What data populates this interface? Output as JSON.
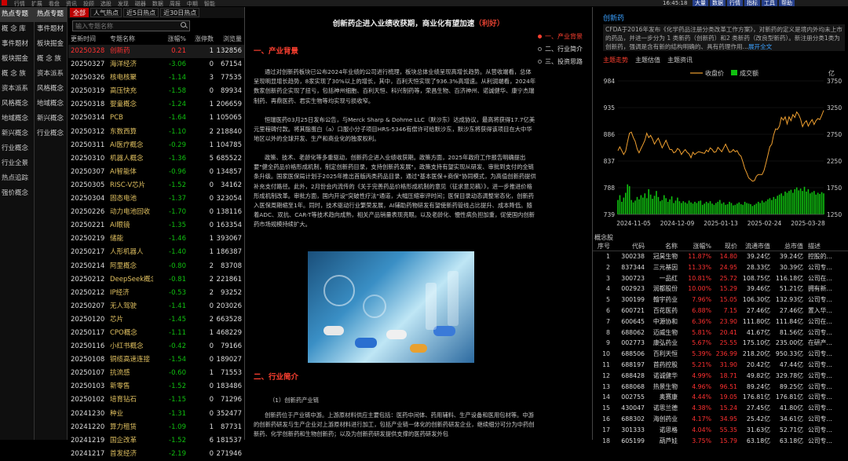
{
  "menubar": {
    "items": [
      "行情",
      "扩展",
      "看盘",
      "资讯",
      "投顾",
      "选股",
      "发现",
      "磁器",
      "数据",
      "周报",
      "中期",
      "智能"
    ],
    "clock": "16:45:18",
    "buttons": [
      "大量",
      "数据",
      "行情",
      "指标",
      "工具",
      "帮助"
    ]
  },
  "sidebar_primary": [
    "热点专题",
    "概 念 库",
    "事件题材",
    "板块掘金",
    "概 念 族",
    "资本派系",
    "风格概念",
    "地域概念",
    "新兴概念",
    "行业概念",
    "行业全景",
    "热点追踪",
    "强价概念"
  ],
  "sidebar_secondary": [
    "热点专题",
    "事件题材",
    "板块掘金",
    "概 念 族",
    "资本派系",
    "风格概念",
    "地域概念",
    "新兴概念",
    "行业概念"
  ],
  "list_tabs": [
    "全部",
    "人气热点",
    "近5日热点",
    "近30日热点"
  ],
  "search": {
    "placeholder": "输入专题名称"
  },
  "list_header": {
    "date": "更新时间",
    "name": "专题名称",
    "chg": "涨幅%",
    "stocks": "涨停数",
    "views": "浏览量"
  },
  "list_rows": [
    {
      "date": "20250328",
      "name": "创新药",
      "chg": "0.21",
      "stocks": "1",
      "views": "132856",
      "sel": true
    },
    {
      "date": "20250327",
      "name": "海洋经济",
      "chg": "-3.06",
      "stocks": "0",
      "views": "67154"
    },
    {
      "date": "20250326",
      "name": "核电核聚",
      "chg": "-1.14",
      "stocks": "3",
      "views": "77535"
    },
    {
      "date": "20250319",
      "name": "高压快充",
      "chg": "-1.58",
      "stocks": "0",
      "views": "89934"
    },
    {
      "date": "20250318",
      "name": "婴童概念",
      "chg": "-1.24",
      "stocks": "1",
      "views": "206659"
    },
    {
      "date": "20250314",
      "name": "PCB",
      "chg": "-1.64",
      "stocks": "1",
      "views": "105065"
    },
    {
      "date": "20250312",
      "name": "东数西算",
      "chg": "-1.10",
      "stocks": "2",
      "views": "218840"
    },
    {
      "date": "20250311",
      "name": "AI医疗概念",
      "chg": "-0.29",
      "stocks": "1",
      "views": "104785"
    },
    {
      "date": "20250310",
      "name": "机器人概念",
      "chg": "-1.36",
      "stocks": "5",
      "views": "685522"
    },
    {
      "date": "20250307",
      "name": "AI智能体",
      "chg": "-0.96",
      "stocks": "0",
      "views": "134857"
    },
    {
      "date": "20250305",
      "name": "RISC-V芯片",
      "chg": "-1.52",
      "stocks": "0",
      "views": "34162"
    },
    {
      "date": "20250304",
      "name": "固态电池",
      "chg": "-1.37",
      "stocks": "0",
      "views": "323054"
    },
    {
      "date": "20250226",
      "name": "动力电池回收",
      "chg": "-1.70",
      "stocks": "0",
      "views": "138116"
    },
    {
      "date": "20250221",
      "name": "AI眼镜",
      "chg": "-1.35",
      "stocks": "0",
      "views": "163354"
    },
    {
      "date": "20250219",
      "name": "储能",
      "chg": "-1.46",
      "stocks": "1",
      "views": "393067"
    },
    {
      "date": "20250217",
      "name": "人形机器人",
      "chg": "-1.40",
      "stocks": "1",
      "views": "186387"
    },
    {
      "date": "20250214",
      "name": "阿里概念",
      "chg": "-0.80",
      "stocks": "2",
      "views": "83708"
    },
    {
      "date": "20250212",
      "name": "DeepSeek概念",
      "chg": "-0.81",
      "stocks": "2",
      "views": "221861"
    },
    {
      "date": "20250212",
      "name": "IP经济",
      "chg": "-0.53",
      "stocks": "2",
      "views": "93252"
    },
    {
      "date": "20250207",
      "name": "无人驾驶",
      "chg": "-1.41",
      "stocks": "0",
      "views": "203026"
    },
    {
      "date": "20250120",
      "name": "芯片",
      "chg": "-1.45",
      "stocks": "2",
      "views": "663528"
    },
    {
      "date": "20250117",
      "name": "CPO概念",
      "chg": "-1.11",
      "stocks": "1",
      "views": "468229"
    },
    {
      "date": "20250116",
      "name": "小红书概念",
      "chg": "-0.42",
      "stocks": "0",
      "views": "79166"
    },
    {
      "date": "20250108",
      "name": "铜缆高速连接",
      "chg": "-1.54",
      "stocks": "0",
      "views": "189027"
    },
    {
      "date": "20250107",
      "name": "抗流感",
      "chg": "-0.60",
      "stocks": "1",
      "views": "71553"
    },
    {
      "date": "20250103",
      "name": "新零售",
      "chg": "-1.52",
      "stocks": "0",
      "views": "183486"
    },
    {
      "date": "20250102",
      "name": "培育钻石",
      "chg": "-1.15",
      "stocks": "0",
      "views": "71296"
    },
    {
      "date": "20241230",
      "name": "种业",
      "chg": "-1.31",
      "stocks": "0",
      "views": "352477"
    },
    {
      "date": "20241220",
      "name": "算力租赁",
      "chg": "-1.09",
      "stocks": "1",
      "views": "87731"
    },
    {
      "date": "20241219",
      "name": "国企改革",
      "chg": "-1.52",
      "stocks": "6",
      "views": "181537"
    },
    {
      "date": "20241217",
      "name": "首发经济",
      "chg": "-2.19",
      "stocks": "0",
      "views": "271946"
    }
  ],
  "article": {
    "title": "创新药企进入业绩收获期，商业化有望加速",
    "title_tag": "（利好）",
    "sec1": "一、产业背景",
    "p1": "通过对创新药板块已公布2024年业绩的公司进行梳理，板块总体业绩呈现高增长趋势。从营收端看，总体呈现明显增长趋势，8家实现了30%以上的增长，其中，百利天恒实现了936.3%高增速。从利润端看，2024年数家创新药企实现了扭亏，包括神州细胞、百利天恒、科兴制药等，荣昌生物、百济神州、诺诚健华、康宁杰瑞制药、再鼎医药、君实生物等均实现亏损收窄。",
    "p2": "恒瑞医药03月25日发布公告，与Merck Sharp & Dohme LLC（默沙东）达成协议，最高将获得17.7亿美元里程碑付款。将其脂蛋白（a）口服小分子项目HRS-5346有偿许可给默沙东，默沙东将获得该项目在大中华地区以外的全球开发、生产和商业化的独家权利。",
    "p3": "政策、技术、老龄化等多重驱动，创新药企进入业绩收获期。政策方面，2025年政府工作报告明确提出要\"健全药品价格形成机制，制定创新药目录，支持创新药发展\"，政策支持有望实现从研发、审批到支付的全链条升级。国家医保局计划于2025年推出首版丙类药品目录，通过\"基本医保+商保\"协同模式，为高值创新药提供补充支付路径。此外，2月份会内流传的《关于完善药品价格形成机制的意见（征求意见稿）》，进一步推进价格形成机制改革。审批方面，国内开设\"突破性疗法\"通道，大幅压缩审评时间；医保目录动态调整常态化，创新药入医保周期缩至1年。同时，技术驱动行业繁荣发展，AI辅助药物研发有望使新药管线占比提升、成本降低。随着ADC、双抗、CAR-T等技术趋向成熟，相关产品销量表现亮眼。以及老龄化、慢性病负担加重，促使国内创新药市场规模持续扩大。",
    "sec2": "二、行业简介",
    "sub1": "（1）创新药产业链",
    "p4": "创新药位于产业链中游。上游原材料供应主要包括：医药中间体、药用辅料、生产设备和医用包材等。中游的创新药研发与生产企业对上游原材料进行加工，包括产业链一体化的创新药研发企业，继续细分可分为中药创新药、化学创新药和生物创新药；以及为创新药研发提供支撑的医药研发外包"
  },
  "toc": [
    "一、产业背景",
    "二、行业简介",
    "三、投资思路"
  ],
  "right": {
    "title": "创新药",
    "desc": "CFDA于2016年发布《化学药品注册分类改革工作方案》，对新药的定义是境内外均未上市的药品，并进一步分为 1 类新药（创新药）和2 类新药（改良型新药）。新注册分类1类为创新药，强调是含有新的结构明确的、具有药理作用...",
    "more": "展开全文",
    "tabs": [
      "主题走势",
      "主题估值",
      "主题资讯"
    ]
  },
  "chart_data": {
    "type": "line",
    "legend": [
      "收盘价",
      "成交额"
    ],
    "ylim": [
      739,
      984
    ],
    "y_ticks": [
      "984",
      "935",
      "886",
      "837",
      "788",
      "739"
    ],
    "y2_ticks": [
      "3750",
      "3250",
      "2750",
      "2250",
      "1750",
      "1250"
    ],
    "y2_unit": "亿",
    "x_ticks": [
      "2024-11-05",
      "2024-12-09",
      "2025-01-13",
      "2025-02-24",
      "2025-03-28"
    ],
    "close": [
      856,
      863,
      856,
      849,
      855,
      872,
      888,
      890,
      880,
      873,
      859,
      852,
      860,
      867,
      875,
      888,
      880,
      884,
      877,
      868,
      874,
      879,
      870,
      861,
      868,
      875,
      866,
      858,
      858,
      852,
      854,
      860,
      857,
      849,
      854,
      858,
      853,
      850,
      843,
      853,
      849,
      852,
      854,
      853,
      852,
      851,
      857,
      854,
      861,
      858,
      853,
      854,
      862,
      858,
      854,
      861,
      868,
      860,
      853,
      854,
      858,
      854,
      856,
      849,
      846,
      835,
      823,
      815,
      806,
      803,
      800,
      801,
      809,
      812,
      812,
      812,
      820,
      833,
      848,
      863,
      868,
      885,
      896,
      895,
      901,
      917,
      912,
      918,
      905,
      918,
      911,
      922,
      917,
      927,
      922,
      914,
      900,
      907,
      911,
      901,
      908,
      913,
      904,
      911,
      915,
      913,
      921,
      930
    ],
    "volume": [
      0.24,
      0.32,
      0.21,
      0.28,
      0.36,
      0.5,
      0.47,
      0.24,
      0.2,
      0.23,
      0.29,
      0.25,
      0.32,
      0.28,
      0.35,
      0.27,
      0.42,
      0.33,
      0.26,
      0.31,
      0.39,
      0.29,
      0.22,
      0.24,
      0.32,
      0.27,
      0.21,
      0.25,
      0.3,
      0.19,
      0.23,
      0.28,
      0.22,
      0.19,
      0.22,
      0.2,
      0.18,
      0.23,
      0.2,
      0.18,
      0.21,
      0.19,
      0.22,
      0.23,
      0.16,
      0.18,
      0.21,
      0.19,
      0.22,
      0.18,
      0.16,
      0.19,
      0.21,
      0.24,
      0.18,
      0.2,
      0.16,
      0.17,
      0.21,
      0.19,
      0.15,
      0.16,
      0.18,
      0.2,
      0.17,
      0.16,
      0.21,
      0.19,
      0.18,
      0.17,
      0.14,
      0.16,
      0.18,
      0.21,
      0.19,
      0.23,
      0.2,
      0.22,
      0.25,
      0.27,
      0.24,
      0.29,
      0.26,
      0.31,
      0.33,
      0.35,
      0.31,
      0.38,
      0.36,
      0.39,
      0.41,
      0.36,
      0.42,
      0.45,
      0.4,
      0.43,
      0.39,
      0.46,
      0.38,
      0.42,
      0.35,
      0.37,
      0.39,
      0.33,
      0.36,
      0.34,
      0.37,
      0.35
    ]
  },
  "concept_label": "概念股",
  "concept_header": {
    "seq": "序号",
    "code": "代码",
    "name": "名称",
    "pct": "涨幅%",
    "price": "现价",
    "float": "流通市值",
    "total": "总市值",
    "note": "描述"
  },
  "concept_rows": [
    {
      "seq": "1",
      "code": "300238",
      "name": "冠昊生物",
      "pct": "11.87%",
      "price": "14.80",
      "float": "39.24亿",
      "total": "39.24亿",
      "note": "控股的..."
    },
    {
      "seq": "2",
      "code": "837344",
      "name": "三元基因",
      "pct": "11.33%",
      "price": "24.95",
      "float": "28.33亿",
      "total": "30.39亿",
      "note": "公司专..."
    },
    {
      "seq": "3",
      "code": "300723",
      "name": "一品红",
      "pct": "10.81%",
      "price": "25.72",
      "float": "108.75亿",
      "total": "116.18亿",
      "note": "公司在..."
    },
    {
      "seq": "4",
      "code": "002923",
      "name": "润都股份",
      "pct": "10.00%",
      "price": "15.29",
      "float": "39.46亿",
      "total": "51.21亿",
      "note": "拥有新..."
    },
    {
      "seq": "5",
      "code": "300199",
      "name": "翰宇药业",
      "pct": "7.96%",
      "price": "15.05",
      "float": "106.30亿",
      "total": "132.93亿",
      "note": "公司专..."
    },
    {
      "seq": "6",
      "code": "600721",
      "name": "百花医药",
      "pct": "6.88%",
      "price": "7.15",
      "float": "27.46亿",
      "total": "27.46亿",
      "note": "置入华..."
    },
    {
      "seq": "7",
      "code": "600645",
      "name": "中源协和",
      "pct": "6.36%",
      "price": "23.90",
      "float": "111.80亿",
      "total": "111.84亿",
      "note": "公司在..."
    },
    {
      "seq": "8",
      "code": "688062",
      "name": "迈威生物",
      "pct": "5.81%",
      "price": "20.41",
      "float": "41.67亿",
      "total": "81.56亿",
      "note": "公司专..."
    },
    {
      "seq": "9",
      "code": "002773",
      "name": "康弘药业",
      "pct": "5.67%",
      "price": "25.55",
      "float": "175.10亿",
      "total": "235.00亿",
      "note": "在研产..."
    },
    {
      "seq": "10",
      "code": "688506",
      "name": "百利天恒",
      "pct": "5.39%",
      "price": "236.99",
      "float": "218.20亿",
      "total": "950.33亿",
      "note": "公司专..."
    },
    {
      "seq": "11",
      "code": "688197",
      "name": "首药控股",
      "pct": "5.21%",
      "price": "31.90",
      "float": "20.42亿",
      "total": "47.44亿",
      "note": "公司专..."
    },
    {
      "seq": "12",
      "code": "688428",
      "name": "诺诚健华",
      "pct": "4.99%",
      "price": "18.71",
      "float": "49.82亿",
      "total": "329.78亿",
      "note": "公司专..."
    },
    {
      "seq": "13",
      "code": "688068",
      "name": "热景生物",
      "pct": "4.96%",
      "price": "96.51",
      "float": "89.24亿",
      "total": "89.25亿",
      "note": "公司专..."
    },
    {
      "seq": "14",
      "code": "002755",
      "name": "奥赛康",
      "pct": "4.44%",
      "price": "19.05",
      "float": "176.81亿",
      "total": "176.81亿",
      "note": "公司专..."
    },
    {
      "seq": "15",
      "code": "430047",
      "name": "诺思兰德",
      "pct": "4.38%",
      "price": "15.24",
      "float": "27.45亿",
      "total": "41.80亿",
      "note": "公司专..."
    },
    {
      "seq": "16",
      "code": "688302",
      "name": "海创药业",
      "pct": "4.17%",
      "price": "34.95",
      "float": "25.42亿",
      "total": "34.61亿",
      "note": "公司专..."
    },
    {
      "seq": "17",
      "code": "301333",
      "name": "诺思格",
      "pct": "4.04%",
      "price": "55.35",
      "float": "31.63亿",
      "total": "52.71亿",
      "note": "公司专..."
    },
    {
      "seq": "18",
      "code": "605199",
      "name": "葫芦娃",
      "pct": "3.75%",
      "price": "15.79",
      "float": "63.18亿",
      "total": "63.18亿",
      "note": "公司专..."
    }
  ],
  "colors": {
    "accent_red": "#ff3030",
    "down_green": "#10c010",
    "link_blue": "#3aa0ff",
    "line_orange": "#f0a030"
  }
}
